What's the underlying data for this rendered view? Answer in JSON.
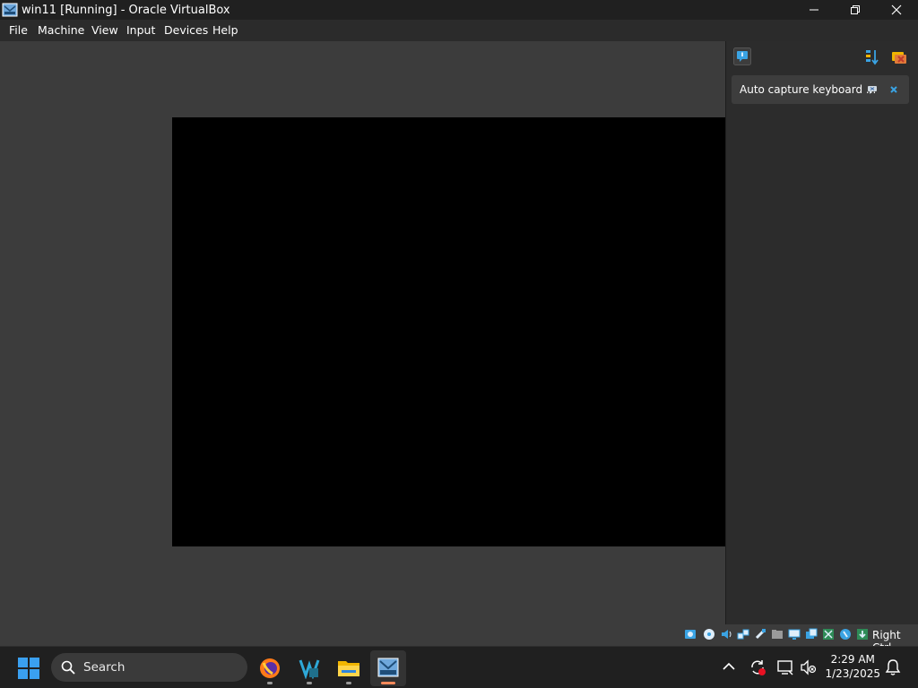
{
  "window": {
    "title": "win11 [Running] - Oracle VirtualBox",
    "icon": "virtualbox-icon",
    "controls": [
      "minimize-icon",
      "restore-icon",
      "close-icon"
    ]
  },
  "menubar": {
    "items": [
      "File",
      "Machine",
      "View",
      "Input",
      "Devices",
      "Help"
    ]
  },
  "notification_center": {
    "header_icons": [
      "notification-center-icon",
      "sort-icon",
      "clear-all-icon"
    ],
    "notification": {
      "text": "Auto capture keyboard ...",
      "actions": [
        "do-not-show-again-icon",
        "close-icon"
      ]
    }
  },
  "statusbar": {
    "icons": [
      "hard-disk-icon",
      "optical-drive-icon",
      "audio-icon",
      "network-icon",
      "usb-icon",
      "shared-folders-icon",
      "display-icon",
      "recording-icon",
      "vt-x-icon",
      "mouse-integration-icon",
      "keyboard-capture-icon"
    ],
    "host_key": "Right Ctrl"
  },
  "taskbar": {
    "search_placeholder": "Search",
    "apps": [
      "firefox-icon",
      "visual-studio-icon",
      "file-explorer-icon",
      "virtualbox-icon"
    ],
    "active_app": "virtualbox-icon",
    "time": "2:29 AM",
    "date": "1/23/2025"
  },
  "colors": {
    "accent_blue": "#3aa3e3",
    "taskbar_active": "#ff8a5b",
    "vm_background": "#3c3c3c"
  }
}
